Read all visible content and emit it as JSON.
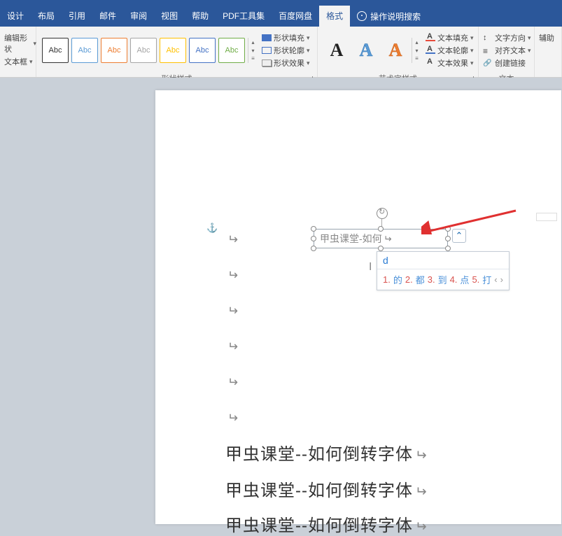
{
  "tabs": {
    "design": "设计",
    "layout": "布局",
    "references": "引用",
    "mailings": "邮件",
    "review": "审阅",
    "view": "视图",
    "help": "帮助",
    "pdf": "PDF工具集",
    "baidu": "百度网盘",
    "format": "格式",
    "tell_me": "操作说明搜索"
  },
  "ribbon": {
    "edit_shape": "编辑形状",
    "text_box": "文本框",
    "style_abc": "Abc",
    "shape_styles_label": "形状样式",
    "shape_fill": "形状填充",
    "shape_outline": "形状轮廓",
    "shape_effects": "形状效果",
    "wordart_label": "艺术字样式",
    "wa_A": "A",
    "text_fill": "文本填充",
    "text_outline": "文本轮廓",
    "text_effects": "文本效果",
    "text_dir": "文字方向",
    "align_text": "对齐文本",
    "create_link": "创建链接",
    "text_label": "文本",
    "acc_label": "辅助"
  },
  "doc": {
    "textbox_value": "甲虫课堂-如何",
    "ime_input": "d",
    "ime_candidates": [
      {
        "n": "1.",
        "c": "的"
      },
      {
        "n": "2.",
        "c": "都"
      },
      {
        "n": "3.",
        "c": "到"
      },
      {
        "n": "4.",
        "c": "点"
      },
      {
        "n": "5.",
        "c": "打"
      }
    ],
    "body_line": "甲虫课堂--如何倒转字体",
    "para": "↵"
  }
}
